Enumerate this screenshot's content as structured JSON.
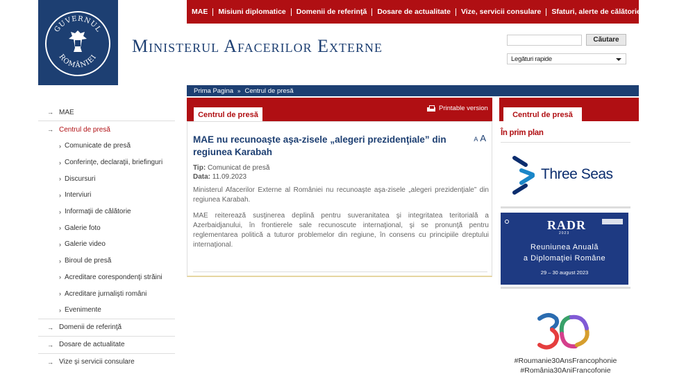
{
  "brand": {
    "title": "Ministerul Afacerilor Externe",
    "seal_text": "GUVERNUL ROMÂNIEI",
    "colors": {
      "navy": "#1d3f72",
      "red": "#b00f13"
    }
  },
  "top_nav": {
    "items": [
      "MAE",
      "Misiuni diplomatice",
      "Domenii de referinţă",
      "Dosare de actualitate",
      "Vize, servicii consulare",
      "Sfaturi, alerte de călătorie"
    ]
  },
  "search": {
    "button_label": "Căutare",
    "placeholder": ""
  },
  "quick_links": {
    "selected": "Legături rapide"
  },
  "sidebar": {
    "top": [
      {
        "label": "MAE"
      },
      {
        "label": "Centrul de presă"
      }
    ],
    "sub": [
      "Comunicate de presă",
      "Conferinţe, declaraţii, briefinguri",
      "Discursuri",
      "Interviuri",
      "Informaţii de călătorie",
      "Galerie foto",
      "Galerie video",
      "Biroul de presă",
      "Acreditare corespondenţi străini",
      "Acreditare jurnalişti români",
      "Evenimente"
    ],
    "bottom": [
      "Domenii de referinţă",
      "Dosare de actualitate",
      "Vize şi servicii consulare"
    ]
  },
  "breadcrumb": {
    "home": "Prima Pagina",
    "sep": "»",
    "current": "Centrul de presă"
  },
  "main": {
    "tab_label": "Centrul de presă",
    "printable": "Printable version",
    "font_small": "A",
    "font_big": "A",
    "article": {
      "title": "MAE nu recunoaşte aşa-zisele „alegeri prezidenţiale” din regiunea Karabah",
      "type_label": "Tip:",
      "type_value": "Comunicat de presă",
      "date_label": "Data:",
      "date_value": "11.09.2023",
      "para1": "Ministerul Afacerilor Externe al României nu recunoaşte aşa-zisele „alegeri prezidenţiale” din regiunea Karabah.",
      "para2": "MAE reiterează susţinerea deplină pentru suveranitatea şi integritatea teritorială a Azerbaidjanului, în frontierele sale recunoscute internaţional, şi se pronunţă pentru reglementarea politică a tuturor problemelor din regiune, în consens cu principiile dreptului internaţional."
    }
  },
  "right": {
    "tab_label": "Centrul de presă",
    "section_title": "În prim plan",
    "three_seas": "Three Seas",
    "radr": {
      "logo": "RADR",
      "year": "2023",
      "line1": "Reuniunea Anuală",
      "line2": "a Diplomaţiei Române",
      "dates": "29 – 30 august 2023"
    },
    "francophonie": {
      "number": "30",
      "tag1": "#Roumanie30AnsFrancophonie",
      "tag2": "#România30AniFrancofonie"
    }
  }
}
